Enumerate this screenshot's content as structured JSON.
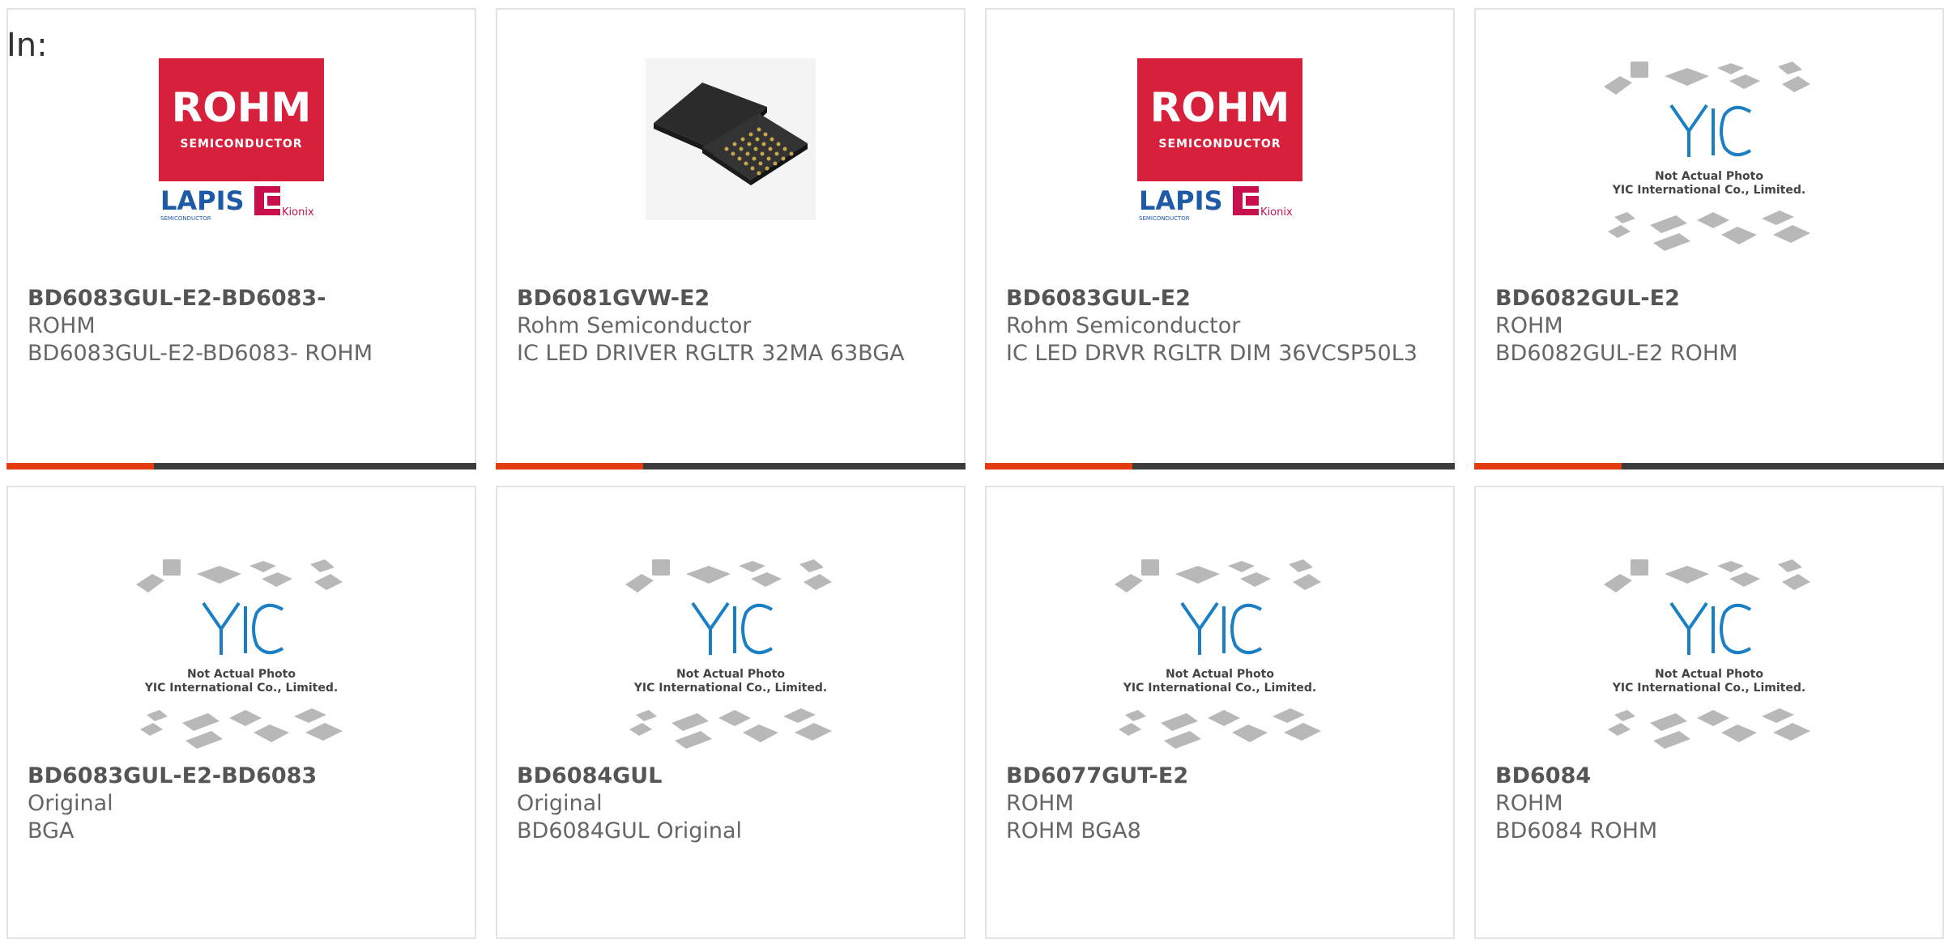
{
  "page_label": "In:",
  "colors": {
    "accent": "#e53b10",
    "bar": "#3b3b3b",
    "rohm_red": "#d6203c",
    "yic_blue": "#1a7fc4"
  },
  "logo_texts": {
    "rohm": "ROHM",
    "semiconductor": "SEMICONDUCTOR",
    "lapis": "LAPIS",
    "lapis_sub": "SEMICONDUCTOR",
    "kionix": "Kionix"
  },
  "placeholder_texts": {
    "line1": "Not Actual Photo",
    "line2": "YIC International Co., Limited."
  },
  "products": [
    {
      "part_number": "BD6083GUL-E2-BD6083-",
      "manufacturer": "ROHM",
      "description": "BD6083GUL-E2-BD6083- ROHM",
      "image": "rohm-lapis-logo"
    },
    {
      "part_number": "BD6081GVW-E2",
      "manufacturer": "Rohm Semiconductor",
      "description": "IC LED DRIVER RGLTR 32MA 63BGA",
      "image": "bga-chip-photo"
    },
    {
      "part_number": "BD6083GUL-E2",
      "manufacturer": "Rohm Semiconductor",
      "description": "IC LED DRVR RGLTR DIM 36VCSP50L3",
      "image": "rohm-lapis-logo"
    },
    {
      "part_number": "BD6082GUL-E2",
      "manufacturer": "ROHM",
      "description": "BD6082GUL-E2 ROHM",
      "image": "yic-placeholder"
    },
    {
      "part_number": "BD6083GUL-E2-BD6083",
      "manufacturer": "Original",
      "description": "BGA",
      "image": "yic-placeholder"
    },
    {
      "part_number": "BD6084GUL",
      "manufacturer": "Original",
      "description": "BD6084GUL Original",
      "image": "yic-placeholder"
    },
    {
      "part_number": "BD6077GUT-E2",
      "manufacturer": "ROHM",
      "description": "ROHM BGA8",
      "image": "yic-placeholder"
    },
    {
      "part_number": "BD6084",
      "manufacturer": "ROHM",
      "description": "BD6084 ROHM",
      "image": "yic-placeholder"
    }
  ]
}
